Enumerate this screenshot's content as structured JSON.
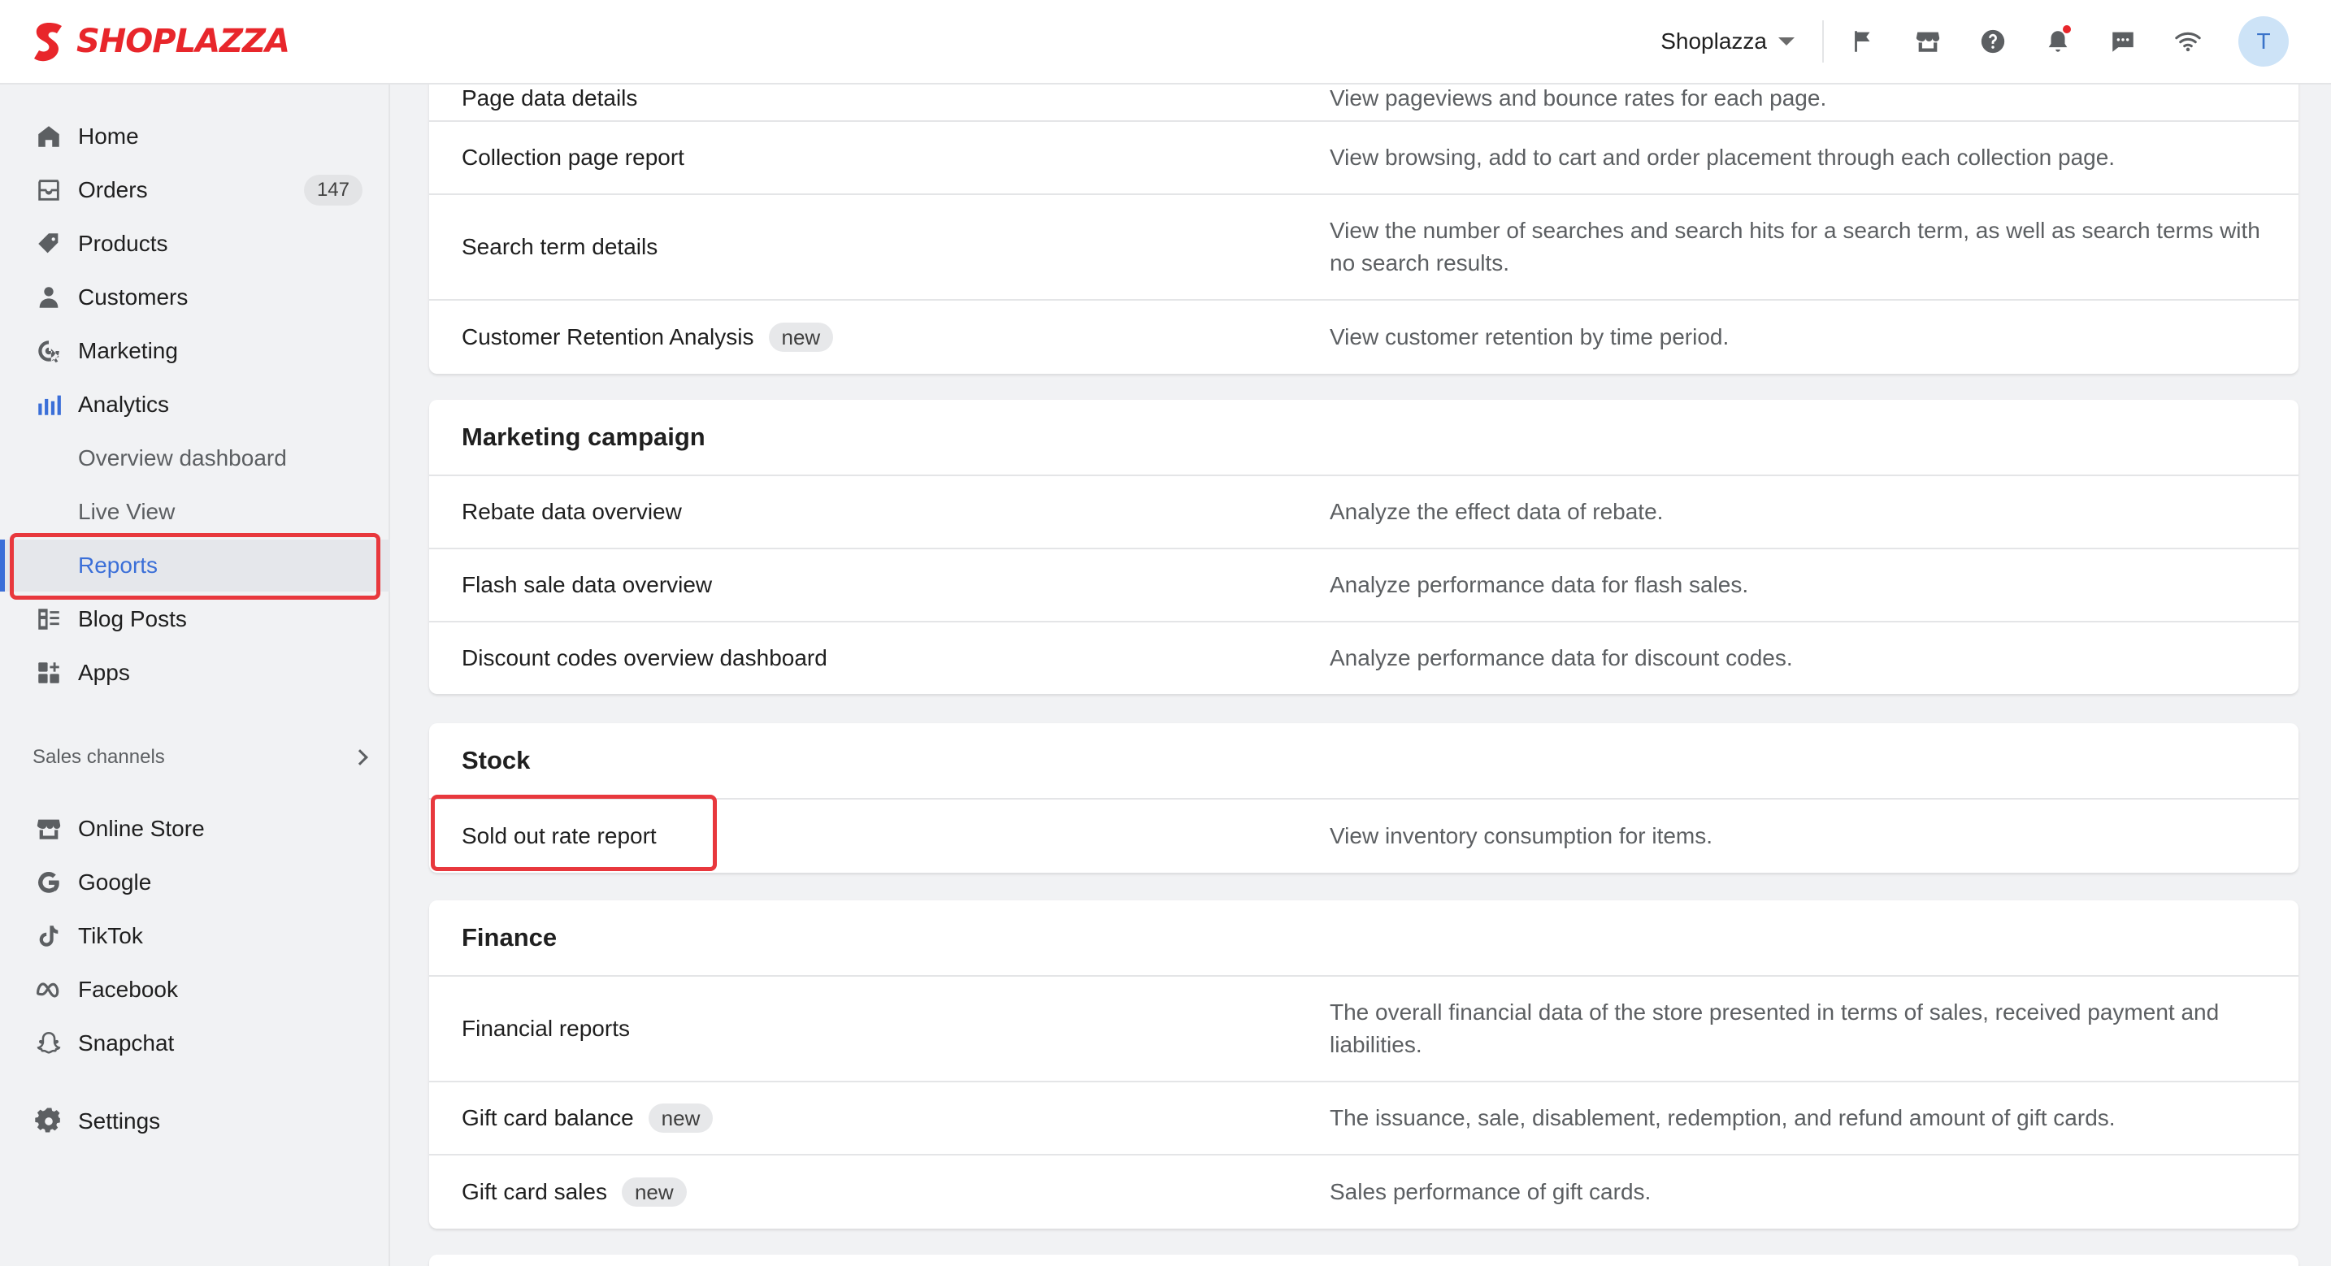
{
  "brand": {
    "name": "SHOPLAZZA",
    "color": "#e8262b"
  },
  "header": {
    "store_name": "Shoplazza",
    "avatar_initial": "T",
    "icons": [
      "flag-icon",
      "store-icon",
      "help-icon",
      "bell-icon",
      "chat-icon",
      "wifi-icon"
    ]
  },
  "sidebar": {
    "items": [
      {
        "label": "Home",
        "icon": "home-icon"
      },
      {
        "label": "Orders",
        "icon": "orders-icon",
        "badge": "147"
      },
      {
        "label": "Products",
        "icon": "tag-icon"
      },
      {
        "label": "Customers",
        "icon": "person-icon"
      },
      {
        "label": "Marketing",
        "icon": "marketing-icon"
      },
      {
        "label": "Analytics",
        "icon": "chart-icon"
      }
    ],
    "analytics_sub": [
      {
        "label": "Overview dashboard"
      },
      {
        "label": "Live View"
      },
      {
        "label": "Reports",
        "active": true
      }
    ],
    "items2": [
      {
        "label": "Blog Posts",
        "icon": "blog-icon"
      },
      {
        "label": "Apps",
        "icon": "apps-icon"
      }
    ],
    "sales_channels_label": "Sales channels",
    "channels": [
      {
        "label": "Online Store",
        "icon": "store-icon"
      },
      {
        "label": "Google",
        "icon": "google-icon"
      },
      {
        "label": "TikTok",
        "icon": "tiktok-icon"
      },
      {
        "label": "Facebook",
        "icon": "meta-icon"
      },
      {
        "label": "Snapchat",
        "icon": "snapchat-icon"
      }
    ],
    "settings_label": "Settings",
    "accent": "#3b6fd8"
  },
  "reports": {
    "top_partial": {
      "name": "Page data details",
      "desc": "View pageviews and bounce rates for each page."
    },
    "top_rows": [
      {
        "name": "Collection page report",
        "desc": "View browsing, add to cart and order placement through each collection page."
      },
      {
        "name": "Search term details",
        "desc": "View the number of searches and search hits for a search term, as well as search terms with no search results."
      },
      {
        "name": "Customer Retention Analysis",
        "tag": "new",
        "desc": "View customer retention by time period."
      }
    ],
    "marketing": {
      "title": "Marketing campaign",
      "rows": [
        {
          "name": "Rebate data overview",
          "desc": "Analyze the effect data of rebate."
        },
        {
          "name": "Flash sale data overview",
          "desc": "Analyze performance data for flash sales."
        },
        {
          "name": "Discount codes overview dashboard",
          "desc": "Analyze performance data for discount codes."
        }
      ]
    },
    "stock": {
      "title": "Stock",
      "rows": [
        {
          "name": "Sold out rate report",
          "desc": "View inventory consumption for items."
        }
      ]
    },
    "finance": {
      "title": "Finance",
      "rows": [
        {
          "name": "Financial reports",
          "desc": "The overall financial data of the store presented in terms of sales, received payment and liabilities."
        },
        {
          "name": "Gift card balance",
          "tag": "new",
          "desc": "The issuance, sale, disablement, redemption, and refund amount of gift cards."
        },
        {
          "name": "Gift card sales",
          "tag": "new",
          "desc": "Sales performance of gift cards."
        }
      ]
    }
  }
}
